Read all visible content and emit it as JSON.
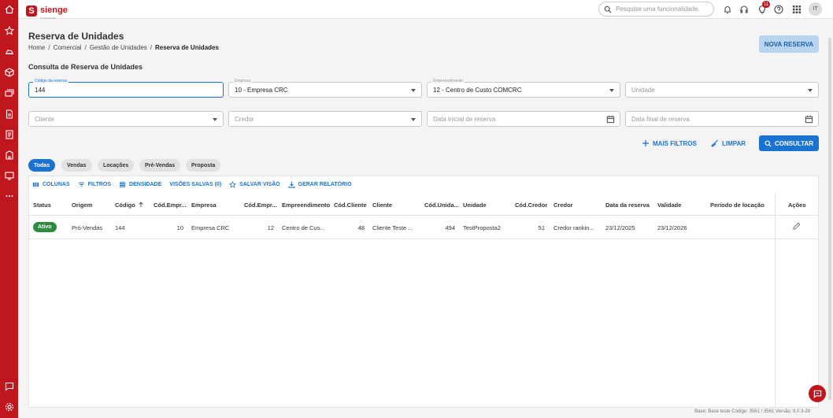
{
  "app": {
    "brand": "sienge",
    "brand_sub": "PLATAFORMA"
  },
  "topbar": {
    "search_placeholder": "Pesquise uma funcionalidade.",
    "notification_count": "11",
    "avatar_initials": "IT"
  },
  "page": {
    "title": "Reserva de Unidades",
    "breadcrumb": [
      "Home",
      "/",
      "Comercial",
      "/",
      "Gestão de Unidades",
      "/",
      "Reserva de Unidades"
    ],
    "new_button": "NOVA RESERVA",
    "section_title": "Consulta de Reserva de Unidades"
  },
  "filters": {
    "codigo": {
      "label": "Código da reserva",
      "value": "144"
    },
    "empresa": {
      "label": "Empresa",
      "value": "10 - Empresa CRC"
    },
    "empreendimento": {
      "label": "Empreendimento",
      "value": "12 - Centro de Custo COMCRC"
    },
    "unidade": {
      "placeholder": "Unidade"
    },
    "cliente": {
      "placeholder": "Cliente"
    },
    "credor": {
      "placeholder": "Credor"
    },
    "data_inicial": {
      "placeholder": "Data inicial de reserva"
    },
    "data_final": {
      "placeholder": "Data final de reserva"
    },
    "mais_filtros": "MAIS FILTROS",
    "limpar": "LIMPAR",
    "consultar": "CONSULTAR"
  },
  "tabs": [
    "Todas",
    "Vendas",
    "Locações",
    "Pré-Vendas",
    "Proposta"
  ],
  "grid_toolbar": {
    "colunas": "COLUNAS",
    "filtros": "FILTROS",
    "densidade": "DENSIDADE",
    "visoes": "VISÕES SALVAS (0)",
    "salvar": "SALVAR VISÃO",
    "relatorio": "GERAR RELATÓRIO"
  },
  "columns": [
    "Status",
    "Origem",
    "Código",
    "Cód.Empr...",
    "Empresa",
    "Cód.Empr...",
    "Empreendimento",
    "Cód.Cliente",
    "Cliente",
    "Cód.Unida...",
    "Unidade",
    "Cód.Credor",
    "Credor",
    "Data da reserva",
    "Validade",
    "Período de locação",
    "Ações"
  ],
  "rows": [
    {
      "status": "Ativo",
      "origem": "Pró-Vendas",
      "codigo": "144",
      "cod_empresa": "10",
      "empresa": "Empresa CRC",
      "cod_empreendimento": "12",
      "empreendimento": "Centro de Cus...",
      "cod_cliente": "48",
      "cliente": "Cliente Teste ...",
      "cod_unidade": "494",
      "unidade": "TestProposta2",
      "cod_credor": "51",
      "credor": "Credor rankin...",
      "data_reserva": "23/12/2025",
      "validade": "23/12/2026",
      "periodo_locacao": ""
    }
  ],
  "footer": "Base: Base teste  Código: 3561 / 3561  Versão: 9.0.3-29",
  "colors": {
    "brand_red": "#c0161d",
    "primary_blue": "#1a73d1",
    "status_green": "#2e8b3e"
  }
}
